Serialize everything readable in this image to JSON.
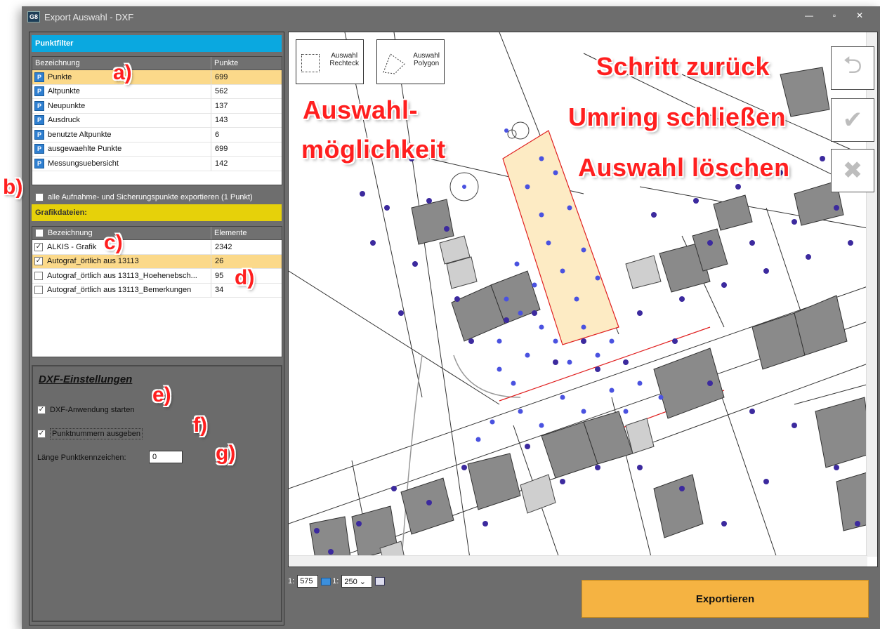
{
  "window": {
    "app_icon": "G8",
    "title": "Export Auswahl -  DXF",
    "minimize": "—",
    "maximize": "▫",
    "close": "✕"
  },
  "punktfilter": {
    "header": "Punktfilter",
    "columns": [
      "Bezeichnung",
      "Punkte"
    ],
    "rows": [
      {
        "name": "Punkte",
        "value": "699",
        "selected": true
      },
      {
        "name": "Altpunkte",
        "value": "562"
      },
      {
        "name": "Neupunkte",
        "value": "137"
      },
      {
        "name": "Ausdruck",
        "value": "143"
      },
      {
        "name": "benutzte Altpunkte",
        "value": "6"
      },
      {
        "name": "ausgewaehlte Punkte",
        "value": "699"
      },
      {
        "name": "Messungsuebersicht",
        "value": "142"
      }
    ],
    "icon_letter": "P"
  },
  "export_all_checkbox": {
    "label": "alle Aufnahme- und Sicherungspunkte exportieren (1 Punkt)",
    "checked": false
  },
  "grafik": {
    "header": "Grafikdateien:",
    "columns": [
      "Bezeichnung",
      "Elemente"
    ],
    "rows": [
      {
        "name": "ALKIS - Grafik",
        "value": "2342",
        "checked": true
      },
      {
        "name": "Autograf_örtlich aus 13113",
        "value": "26",
        "checked": true,
        "selected": true
      },
      {
        "name": "Autograf_örtlich aus 13113_Hoehenebsch...",
        "value": "95",
        "checked": false
      },
      {
        "name": "Autograf_örtlich aus 13113_Bemerkungen",
        "value": "34",
        "checked": false
      }
    ]
  },
  "dxf": {
    "title": "DXF-Einstellungen",
    "start_app": {
      "label": "DXF-Anwendung starten",
      "checked": true
    },
    "point_numbers": {
      "label": "Punktnummern ausgeben",
      "checked": true
    },
    "length_label": "Länge  Punktkennzeichen:",
    "length_value": "0"
  },
  "map": {
    "tool_rect": {
      "line1": "Auswahl",
      "line2": "Rechteck"
    },
    "tool_poly": {
      "line1": "Auswahl",
      "line2": "Polygon"
    },
    "undo_icon": "⮌",
    "confirm_icon": "✔",
    "delete_icon": "✖"
  },
  "annotations": {
    "schritt": "Schritt zurück",
    "umring": "Umring schließen",
    "loeschen": "Auswahl löschen",
    "auswahl1": "Auswahl-",
    "auswahl2": "möglichkeit",
    "a": "a)",
    "b": "b)",
    "c": "c)",
    "d": "d)",
    "e": "e)",
    "f": "f)",
    "g": "g)"
  },
  "scale": {
    "prefix1": "1:",
    "value1": "575",
    "prefix2": "1:",
    "value2": "250"
  },
  "export_button": "Exportieren",
  "colors": {
    "punktfilter": "#0aa8e0",
    "grafik": "#e6d10a",
    "selected_row": "#fbd98a",
    "export": "#f5b342",
    "annotation": "#ff1f1f"
  }
}
